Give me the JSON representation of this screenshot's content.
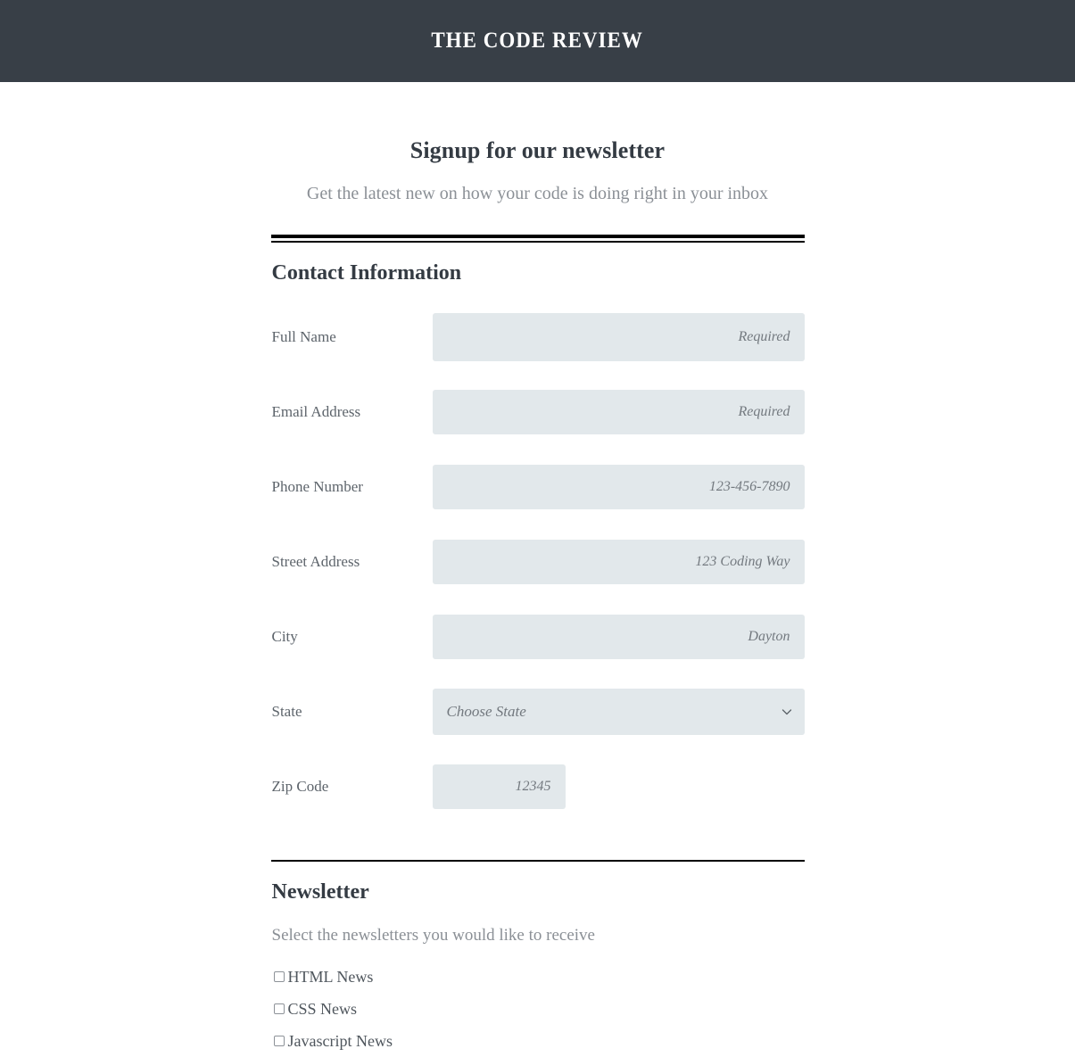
{
  "header": {
    "site_title": "THE CODE REVIEW",
    "background_color": "#383f47"
  },
  "intro": {
    "heading": "Signup for our newsletter",
    "subheading": "Get the latest new on how your code is doing right in your inbox"
  },
  "contact_section": {
    "title": "Contact Information",
    "fields": [
      {
        "label": "Full Name",
        "placeholder": "Required",
        "value": "",
        "type": "text",
        "width": "full"
      },
      {
        "label": "Email Address",
        "placeholder": "Required",
        "value": "",
        "type": "email",
        "width": "full"
      },
      {
        "label": "Phone Number",
        "placeholder": "123-456-7890",
        "value": "",
        "type": "tel",
        "width": "full"
      },
      {
        "label": "Street Address",
        "placeholder": "123 Coding Way",
        "value": "",
        "type": "text",
        "width": "full"
      },
      {
        "label": "City",
        "placeholder": "Dayton",
        "value": "",
        "type": "text",
        "width": "full"
      },
      {
        "label": "Zip Code",
        "placeholder": "12345",
        "value": "",
        "type": "text",
        "width": "short"
      }
    ],
    "state_field": {
      "label": "State",
      "selected_option": "Choose State",
      "dropdown_icon": "chevron-down-icon"
    }
  },
  "newsletter_section": {
    "title": "Newsletter",
    "note": "Select the newsletters you would like to receive",
    "options": [
      {
        "label": "HTML News",
        "checked": false
      },
      {
        "label": "CSS News",
        "checked": false
      },
      {
        "label": "Javascript News",
        "checked": false
      }
    ]
  },
  "colors": {
    "header_bg": "#383f47",
    "input_bg": "#e2e8eb",
    "heading_text": "#343b43",
    "muted_text": "#8b9096",
    "rule": "#000000"
  }
}
